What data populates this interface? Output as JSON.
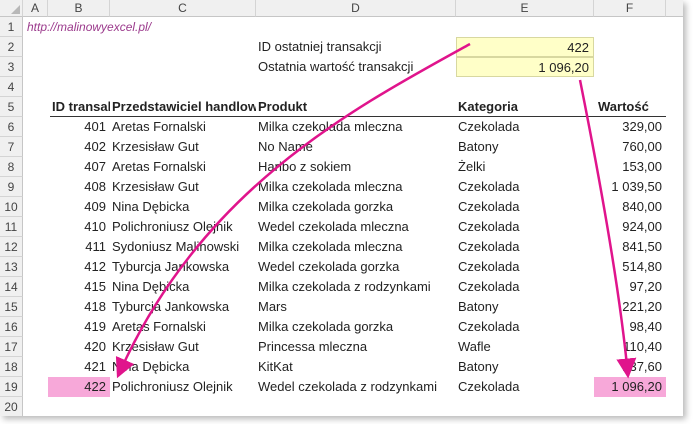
{
  "columns": [
    "A",
    "B",
    "C",
    "D",
    "E",
    "F"
  ],
  "rows": [
    "1",
    "2",
    "3",
    "4",
    "5",
    "6",
    "7",
    "8",
    "9",
    "10",
    "11",
    "12",
    "13",
    "14",
    "15",
    "16",
    "17",
    "18",
    "19",
    "20"
  ],
  "link_text": "http://malinowyexcel.pl/",
  "summary": {
    "id_label": "ID ostatniej transakcji",
    "id_value": "422",
    "value_label": "Ostatnia wartość transakcji",
    "value_value": "1 096,20"
  },
  "headers": {
    "id": "ID transakcji",
    "rep": "Przedstawiciel handlowy",
    "product": "Produkt",
    "category": "Kategoria",
    "value": "Wartość"
  },
  "table": [
    [
      "401",
      "Aretas Fornalski",
      "Milka czekolada mleczna",
      "Czekolada",
      "329,00"
    ],
    [
      "402",
      "Krzesisław Gut",
      "No Name",
      "Batony",
      "760,00"
    ],
    [
      "407",
      "Aretas Fornalski",
      "Haribo z sokiem",
      "Żelki",
      "153,00"
    ],
    [
      "408",
      "Krzesisław Gut",
      "Milka czekolada mleczna",
      "Czekolada",
      "1 039,50"
    ],
    [
      "409",
      "Nina Dębicka",
      "Milka czekolada gorzka",
      "Czekolada",
      "840,00"
    ],
    [
      "410",
      "Polichroniusz Olejnik",
      "Wedel czekolada mleczna",
      "Czekolada",
      "924,00"
    ],
    [
      "411",
      "Sydoniusz Malinowski",
      "Milka czekolada mleczna",
      "Czekolada",
      "841,50"
    ],
    [
      "412",
      "Tyburcja Jankowska",
      "Wedel czekolada gorzka",
      "Czekolada",
      "514,80"
    ],
    [
      "415",
      "Nina Dębicka",
      "Milka czekolada z rodzynkami",
      "Czekolada",
      "97,20"
    ],
    [
      "418",
      "Tyburcja Jankowska",
      "Mars",
      "Batony",
      "221,20"
    ],
    [
      "419",
      "Aretas Fornalski",
      "Milka czekolada gorzka",
      "Czekolada",
      "98,40"
    ],
    [
      "420",
      "Krzesisław Gut",
      "Princessa mleczna",
      "Wafle",
      "110,40"
    ],
    [
      "421",
      "Nina Dębicka",
      "KitKat",
      "Batony",
      "137,60"
    ],
    [
      "422",
      "Polichroniusz Olejnik",
      "Wedel czekolada z rodzynkami",
      "Czekolada",
      "1 096,20"
    ]
  ],
  "colors": {
    "link": "#9b3a8c",
    "highlight_yellow": "#ffffc8",
    "highlight_pink": "#f7a8d9",
    "arrow": "#e0148c"
  }
}
